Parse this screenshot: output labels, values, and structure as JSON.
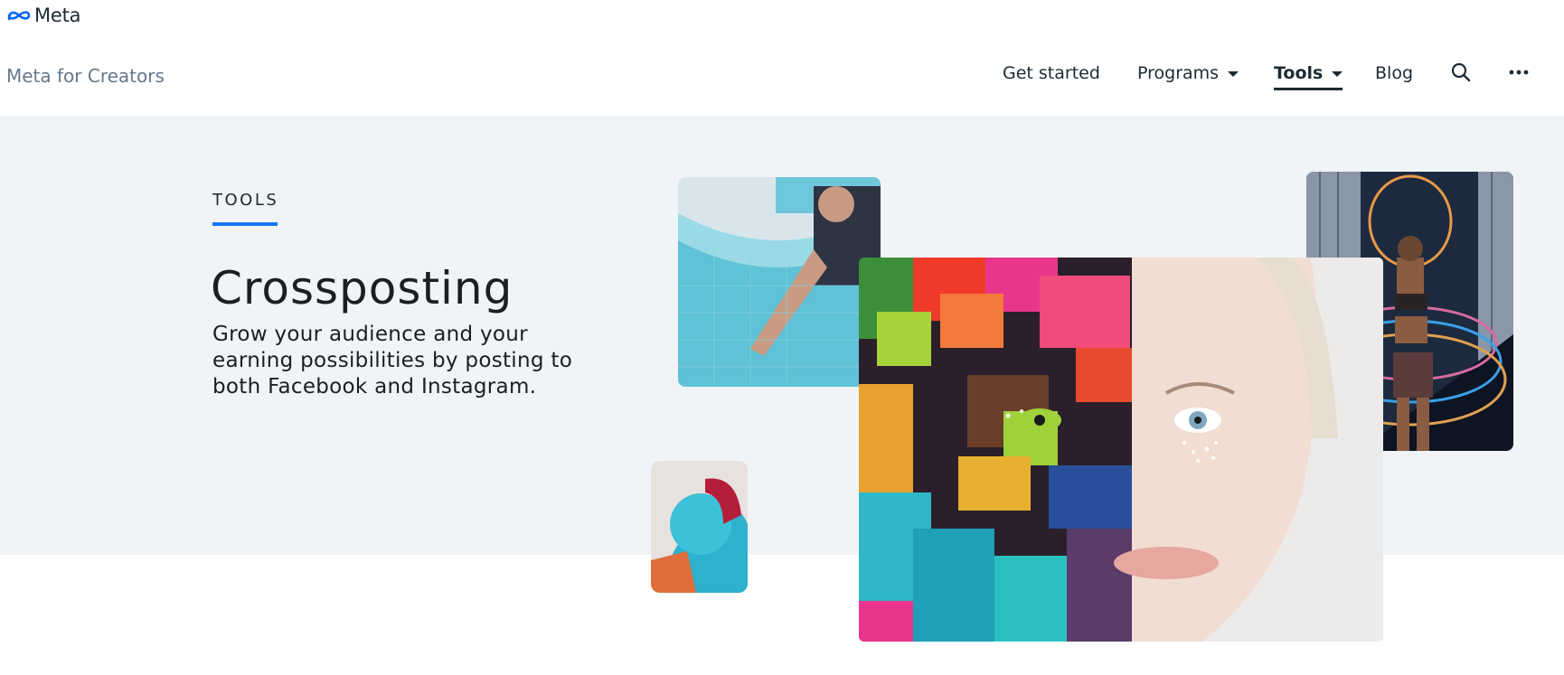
{
  "header": {
    "brand": "Meta",
    "site_name": "Meta for Creators"
  },
  "nav": {
    "items": [
      {
        "label": "Get started"
      },
      {
        "label": "Programs"
      },
      {
        "label": "Tools"
      },
      {
        "label": "Blog"
      }
    ],
    "search_icon": "search-icon",
    "more_icon": "more-horizontal-icon"
  },
  "hero": {
    "eyebrow": "TOOLS",
    "title": "Crossposting",
    "subtitle": "Grow your audience and your earning possibilities by posting to both Facebook and Instagram."
  },
  "colors": {
    "accent": "#1877f2",
    "hero_bg": "#f1f4f7",
    "text": "#1c2b33",
    "muted": "#65788a"
  }
}
